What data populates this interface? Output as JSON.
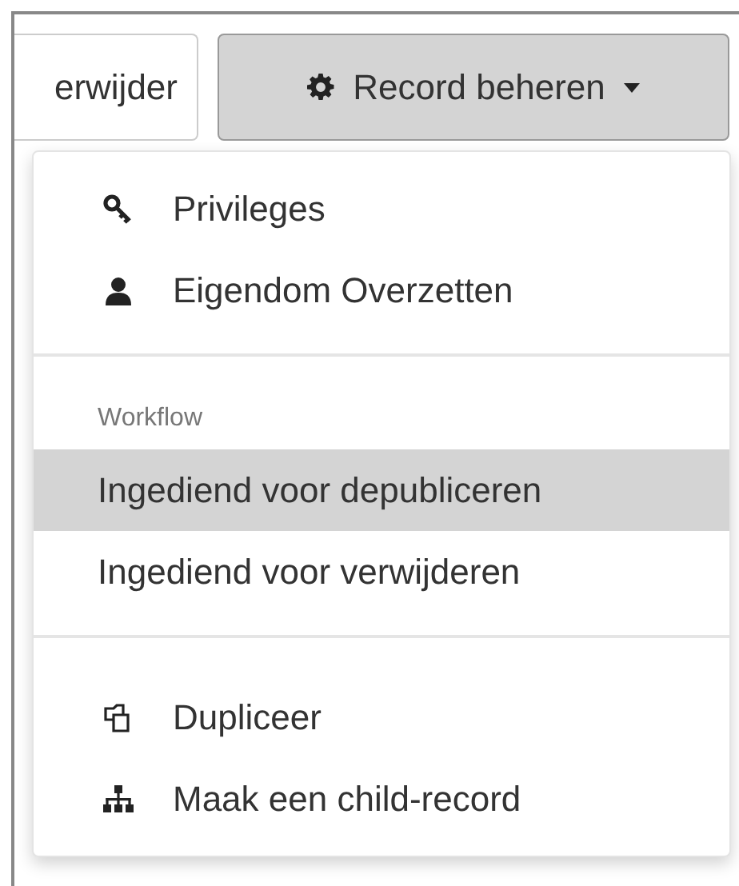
{
  "toolbar": {
    "buttons": [
      {
        "label": "erwijder",
        "kind": "plain",
        "active": false
      },
      {
        "label": "Record beheren",
        "kind": "dropdown",
        "active": true
      }
    ]
  },
  "menu": {
    "sections": [
      {
        "items": [
          {
            "label": "Privileges",
            "kind": "key",
            "selected": false
          },
          {
            "label": "Eigendom Overzetten",
            "kind": "user",
            "selected": false
          }
        ]
      },
      {
        "header": "Workflow",
        "items": [
          {
            "label": "Ingediend voor depubliceren",
            "selected": true
          },
          {
            "label": "Ingediend voor verwijderen",
            "selected": false
          }
        ]
      },
      {
        "items": [
          {
            "label": "Dupliceer",
            "kind": "copy",
            "selected": false
          },
          {
            "label": "Maak een child-record",
            "kind": "sitemap",
            "selected": false
          }
        ]
      }
    ]
  }
}
